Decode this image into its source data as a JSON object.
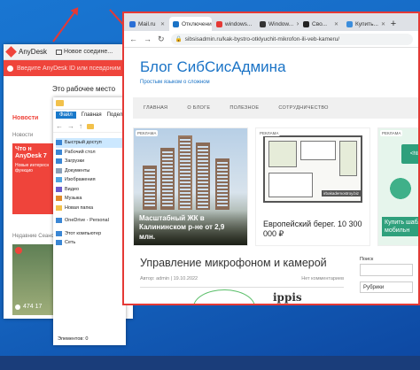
{
  "colors": {
    "desktop": "#1565c0",
    "anydesk_accent": "#ef443b",
    "site_accent": "#1a73c6",
    "highlight": "#e53935"
  },
  "anydesk": {
    "app_name": "AnyDesk",
    "tab_label": "Новое соедине...",
    "address_placeholder": "Введите AnyDesk ID или псевдоним",
    "workplace": "Это рабочее место",
    "news_title": "Новости",
    "news_subtitle": "Новости",
    "promo_heading": "Что н AnyDesk 7",
    "promo_text": "Новые интересн функцио",
    "recent_label": "Недавние Сеансы",
    "recent_id": "474 17"
  },
  "explorer": {
    "tabs": [
      "Файл",
      "Главная",
      "Поделиться"
    ],
    "tree": [
      {
        "label": "Быстрый доступ",
        "icon": "star-icon",
        "active": true
      },
      {
        "label": "Рабочий стол",
        "icon": "desktop-icon"
      },
      {
        "label": "Загрузки",
        "icon": "download-icon"
      },
      {
        "label": "Документы",
        "icon": "document-icon"
      },
      {
        "label": "Изображения",
        "icon": "image-icon"
      },
      {
        "label": "Видео",
        "icon": "video-icon"
      },
      {
        "label": "Музыка",
        "icon": "music-icon"
      },
      {
        "label": "Новая папка",
        "icon": "folder-icon"
      },
      {
        "label": "OneDrive - Personal",
        "icon": "cloud-icon"
      },
      {
        "label": "Этот компьютер",
        "icon": "computer-icon"
      },
      {
        "label": "Сеть",
        "icon": "network-icon"
      }
    ],
    "status": "Элементов: 0"
  },
  "browser": {
    "tabs": [
      {
        "label": "Mail.ru",
        "icon_color": "#2b6fd6"
      },
      {
        "label": "Отключение...",
        "icon_color": "#1a73c6",
        "active": true
      },
      {
        "label": "windows...",
        "icon_color": "#e53935"
      },
      {
        "label": "Window...",
        "icon_color": "#333333"
      },
      {
        "label": "Сво...",
        "icon_color": "#222222"
      },
      {
        "label": "Купить...",
        "icon_color": "#3b8ddc"
      }
    ],
    "url": "sibsisadmin.ru/kak-bystro-otklyuchit-mikrofon-ili-veb-kameru/"
  },
  "site": {
    "title": "Блог СибСисАдмина",
    "tagline": "Простым языком о сложном",
    "menu": [
      "ГЛАВНАЯ",
      "О БЛОГЕ",
      "ПОЛЕЗНОЕ",
      "СОТРУДНИЧЕСТВО"
    ],
    "ads": [
      {
        "badge": "РЕКЛАМА",
        "caption": "Масштабный ЖК в Калининском р-не от 2,9 млн."
      },
      {
        "badge": "РЕКЛАМА",
        "watermark": "irbakademostroy.biz",
        "caption": "Европейский берег. 10 300 000 ₽"
      },
      {
        "badge": "РЕКЛАМА",
        "screen": "<html>",
        "caption": "Купить шабл с мобильн"
      }
    ],
    "post_title": "Управление микрофоном и камерой",
    "author_label": "Автор: admin",
    "date": "19.10.2022",
    "comments": "Нет комментариев",
    "post_logo": "ippis",
    "sidebar_search_label": "Поиск",
    "sidebar_category": "Рубрики"
  }
}
